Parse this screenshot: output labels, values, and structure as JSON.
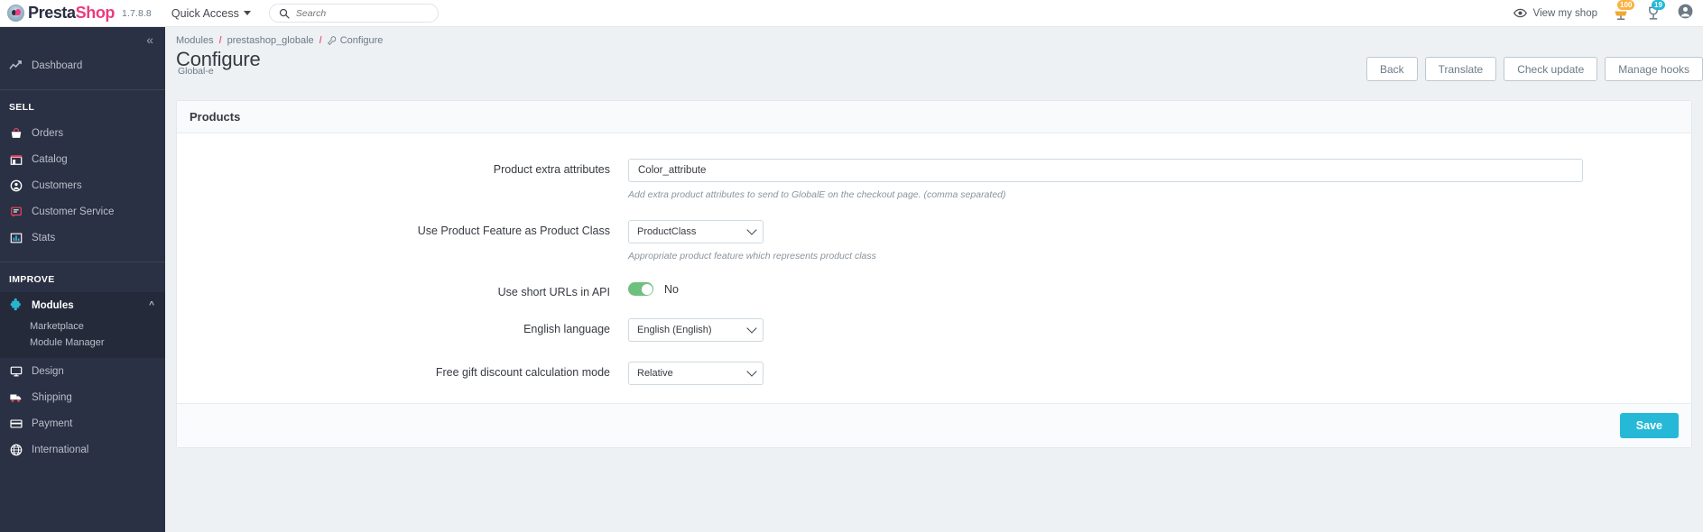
{
  "header": {
    "brand_presta": "Presta",
    "brand_shop": "Shop",
    "version": "1.7.8.8",
    "quick_access": "Quick Access",
    "search_placeholder": "Search",
    "view_shop": "View my shop",
    "cart_badge": "100",
    "notif_badge": "19",
    "accent_pink": "#ec3a7e",
    "accent_blue": "#25b9d7"
  },
  "sidebar": {
    "collapse_glyph": "«",
    "dashboard": "Dashboard",
    "sell_header": "SELL",
    "sell_items": [
      {
        "label": "Orders",
        "icon": "basket-icon"
      },
      {
        "label": "Catalog",
        "icon": "catalog-icon"
      },
      {
        "label": "Customers",
        "icon": "customers-icon"
      },
      {
        "label": "Customer Service",
        "icon": "customer-service-icon"
      },
      {
        "label": "Stats",
        "icon": "stats-icon"
      }
    ],
    "improve_header": "IMPROVE",
    "modules": "Modules",
    "modules_sub": [
      "Marketplace",
      "Module Manager"
    ],
    "improve_items": [
      {
        "label": "Design",
        "icon": "design-icon"
      },
      {
        "label": "Shipping",
        "icon": "shipping-icon"
      },
      {
        "label": "Payment",
        "icon": "payment-icon"
      },
      {
        "label": "International",
        "icon": "international-icon"
      }
    ]
  },
  "breadcrumb": {
    "item1": "Modules",
    "item2": "prestashop_globale",
    "current": "Configure",
    "sep": "/"
  },
  "page": {
    "title": "Configure",
    "subtitle": "Global-e",
    "actions": [
      "Back",
      "Translate",
      "Check update",
      "Manage hooks"
    ]
  },
  "panel": {
    "title": "Products",
    "save_label": "Save",
    "fields": {
      "extra_attributes": {
        "label": "Product extra attributes",
        "value": "Color_attribute",
        "help": "Add extra product attributes to send to GlobalE on the checkout page. (comma separated)"
      },
      "product_class": {
        "label": "Use Product Feature as Product Class",
        "value": "ProductClass",
        "options": [
          "ProductClass"
        ],
        "help": "Appropriate product feature which represents product class"
      },
      "short_urls": {
        "label": "Use short URLs in API",
        "state": "No",
        "toggle_color": "#6fc07e"
      },
      "english_language": {
        "label": "English language",
        "value": "English (English)",
        "options": [
          "English (English)"
        ]
      },
      "free_gift_mode": {
        "label": "Free gift discount calculation mode",
        "value": "Relative",
        "options": [
          "Relative"
        ]
      }
    }
  }
}
